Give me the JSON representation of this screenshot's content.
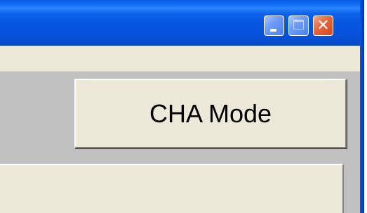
{
  "window": {
    "controls": {
      "minimize": "minimize-icon",
      "maximize": "maximize-icon",
      "close": "close-icon"
    },
    "colors": {
      "titlebar": "#0553dc",
      "menubar": "#ece9d8",
      "content": "#c0c0c0",
      "close": "#e05a2a"
    }
  },
  "main": {
    "mode_button_label": "CHA Mode"
  }
}
